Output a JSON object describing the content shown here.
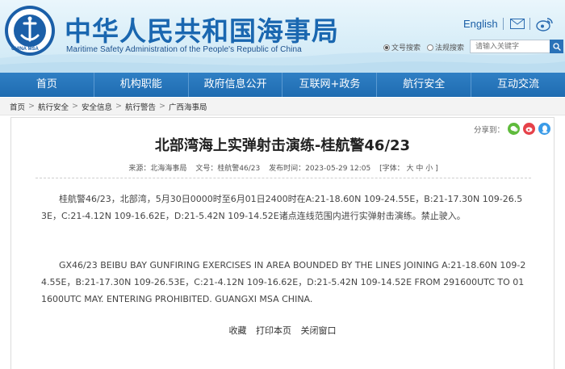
{
  "header": {
    "title": "中华人民共和国海事局",
    "subtitle": "Maritime Safety Administration of the People's Republic of China",
    "logo_text": "CHINA MSA",
    "english_link": "English",
    "search": {
      "option_fulltext": "文号搜索",
      "option_law": "法规搜索",
      "placeholder": "请输入关键字"
    }
  },
  "nav": {
    "items": [
      {
        "label": "首页"
      },
      {
        "label": "机构职能"
      },
      {
        "label": "政府信息公开"
      },
      {
        "label": "互联网+政务"
      },
      {
        "label": "航行安全"
      },
      {
        "label": "互动交流"
      }
    ]
  },
  "breadcrumb": {
    "items": [
      "首页",
      "航行安全",
      "安全信息",
      "航行警告",
      "广西海事局"
    ]
  },
  "article": {
    "share_label": "分享到：",
    "title": "北部湾海上实弹射击演练-桂航警46/23",
    "meta": {
      "source": "来源：北海海事局",
      "doc_no": "文号：桂航警46/23",
      "date": "发布时间：2023-05-29 12:05",
      "font_size": "[字体： 大  中  小 ]"
    },
    "paragraph_cn": "桂航警46/23，北部湾，5月30日0000时至6月01日2400时在A:21-18.60N 109-24.55E，B:21-17.30N 109-26.53E，C:21-4.12N 109-16.62E，D:21-5.42N 109-14.52E诸点连线范围内进行实弹射击演练。禁止驶入。",
    "paragraph_en": "GX46/23 BEIBU BAY GUNFIRING EXERCISES IN AREA BOUNDED BY THE LINES JOINING A:21-18.60N 109-24.55E，B:21-17.30N 109-26.53E，C:21-4.12N 109-16.62E，D:21-5.42N 109-14.52E FROM 291600UTC TO 011600UTC MAY. ENTERING PROHIBITED. GUANGXI MSA CHINA.",
    "actions": {
      "favorite": "收藏",
      "print": "打印本页",
      "close": "关闭窗口"
    }
  },
  "colors": {
    "brand_blue": "#1a67b0",
    "nav_blue": "#2673ba"
  }
}
